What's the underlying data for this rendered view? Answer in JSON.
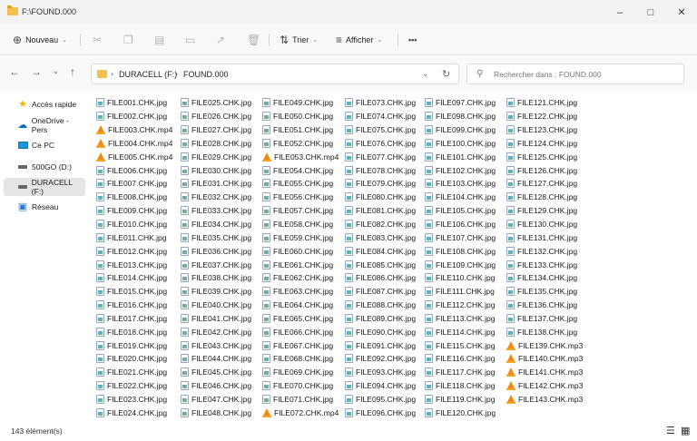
{
  "window": {
    "title": "F:\\FOUND.000"
  },
  "toolbar": {
    "new_label": "Nouveau",
    "sort_label": "Trier",
    "view_label": "Afficher",
    "more_label": "•••"
  },
  "address": {
    "drive": "DURACELL (F:)",
    "folder": "FOUND.000"
  },
  "search": {
    "placeholder": "Rechercher dans : FOUND.000"
  },
  "sidebar": {
    "items": [
      {
        "label": "Accès rapide",
        "icon": "star-icon",
        "color": "#f2b600"
      },
      {
        "label": "OneDrive - Pers",
        "icon": "cloud-icon",
        "color": "#0f6cbd"
      },
      {
        "label": "Ce PC",
        "icon": "monitor-icon",
        "color": "#0f9bd7"
      },
      {
        "label": "500GO (D:)",
        "icon": "drive-icon",
        "color": "#555555"
      },
      {
        "label": "DURACELL (F:)",
        "icon": "drive-icon",
        "color": "#555555",
        "selected": true
      },
      {
        "label": "Réseau",
        "icon": "network-icon",
        "color": "#2b7cd3"
      }
    ]
  },
  "files": [
    {
      "name": "FILE001.CHK.jpg",
      "type": "jpg"
    },
    {
      "name": "FILE002.CHK.jpg",
      "type": "jpg"
    },
    {
      "name": "FILE003.CHK.mp4",
      "type": "vlc"
    },
    {
      "name": "FILE004.CHK.mp4",
      "type": "vlc"
    },
    {
      "name": "FILE005.CHK.mp4",
      "type": "vlc"
    },
    {
      "name": "FILE006.CHK.jpg",
      "type": "jpg"
    },
    {
      "name": "FILE007.CHK.jpg",
      "type": "jpg"
    },
    {
      "name": "FILE008.CHK.jpg",
      "type": "jpg"
    },
    {
      "name": "FILE009.CHK.jpg",
      "type": "jpg"
    },
    {
      "name": "FILE010.CHK.jpg",
      "type": "jpg"
    },
    {
      "name": "FILE011.CHK.jpg",
      "type": "jpg"
    },
    {
      "name": "FILE012.CHK.jpg",
      "type": "jpg"
    },
    {
      "name": "FILE013.CHK.jpg",
      "type": "jpg"
    },
    {
      "name": "FILE014.CHK.jpg",
      "type": "jpg"
    },
    {
      "name": "FILE015.CHK.jpg",
      "type": "jpg"
    },
    {
      "name": "FILE016.CHK.jpg",
      "type": "jpg"
    },
    {
      "name": "FILE017.CHK.jpg",
      "type": "jpg"
    },
    {
      "name": "FILE018.CHK.jpg",
      "type": "jpg"
    },
    {
      "name": "FILE019.CHK.jpg",
      "type": "jpg"
    },
    {
      "name": "FILE020.CHK.jpg",
      "type": "jpg"
    },
    {
      "name": "FILE021.CHK.jpg",
      "type": "jpg"
    },
    {
      "name": "FILE022.CHK.jpg",
      "type": "jpg"
    },
    {
      "name": "FILE023.CHK.jpg",
      "type": "jpg"
    },
    {
      "name": "FILE024.CHK.jpg",
      "type": "jpg"
    },
    {
      "name": "FILE025.CHK.jpg",
      "type": "jpg"
    },
    {
      "name": "FILE026.CHK.jpg",
      "type": "jpg"
    },
    {
      "name": "FILE027.CHK.jpg",
      "type": "jpg"
    },
    {
      "name": "FILE028.CHK.jpg",
      "type": "jpg"
    },
    {
      "name": "FILE029.CHK.jpg",
      "type": "jpg"
    },
    {
      "name": "FILE030.CHK.jpg",
      "type": "jpg"
    },
    {
      "name": "FILE031.CHK.jpg",
      "type": "jpg"
    },
    {
      "name": "FILE032.CHK.jpg",
      "type": "jpg"
    },
    {
      "name": "FILE033.CHK.jpg",
      "type": "jpg"
    },
    {
      "name": "FILE034.CHK.jpg",
      "type": "jpg"
    },
    {
      "name": "FILE035.CHK.jpg",
      "type": "jpg"
    },
    {
      "name": "FILE036.CHK.jpg",
      "type": "jpg"
    },
    {
      "name": "FILE037.CHK.jpg",
      "type": "jpg"
    },
    {
      "name": "FILE038.CHK.jpg",
      "type": "jpg"
    },
    {
      "name": "FILE039.CHK.jpg",
      "type": "jpg"
    },
    {
      "name": "FILE040.CHK.jpg",
      "type": "jpg"
    },
    {
      "name": "FILE041.CHK.jpg",
      "type": "jpg"
    },
    {
      "name": "FILE042.CHK.jpg",
      "type": "jpg"
    },
    {
      "name": "FILE043.CHK.jpg",
      "type": "jpg"
    },
    {
      "name": "FILE044.CHK.jpg",
      "type": "jpg"
    },
    {
      "name": "FILE045.CHK.jpg",
      "type": "jpg"
    },
    {
      "name": "FILE046.CHK.jpg",
      "type": "jpg"
    },
    {
      "name": "FILE047.CHK.jpg",
      "type": "jpg"
    },
    {
      "name": "FILE048.CHK.jpg",
      "type": "jpg"
    },
    {
      "name": "FILE049.CHK.jpg",
      "type": "jpg"
    },
    {
      "name": "FILE050.CHK.jpg",
      "type": "jpg"
    },
    {
      "name": "FILE051.CHK.jpg",
      "type": "jpg"
    },
    {
      "name": "FILE052.CHK.jpg",
      "type": "jpg"
    },
    {
      "name": "FILE053.CHK.mp4",
      "type": "vlc"
    },
    {
      "name": "FILE054.CHK.jpg",
      "type": "jpg"
    },
    {
      "name": "FILE055.CHK.jpg",
      "type": "jpg"
    },
    {
      "name": "FILE056.CHK.jpg",
      "type": "jpg"
    },
    {
      "name": "FILE057.CHK.jpg",
      "type": "jpg"
    },
    {
      "name": "FILE058.CHK.jpg",
      "type": "jpg"
    },
    {
      "name": "FILE059.CHK.jpg",
      "type": "jpg"
    },
    {
      "name": "FILE060.CHK.jpg",
      "type": "jpg"
    },
    {
      "name": "FILE061.CHK.jpg",
      "type": "jpg"
    },
    {
      "name": "FILE062.CHK.jpg",
      "type": "jpg"
    },
    {
      "name": "FILE063.CHK.jpg",
      "type": "jpg"
    },
    {
      "name": "FILE064.CHK.jpg",
      "type": "jpg"
    },
    {
      "name": "FILE065.CHK.jpg",
      "type": "jpg"
    },
    {
      "name": "FILE066.CHK.jpg",
      "type": "jpg"
    },
    {
      "name": "FILE067.CHK.jpg",
      "type": "jpg"
    },
    {
      "name": "FILE068.CHK.jpg",
      "type": "jpg"
    },
    {
      "name": "FILE069.CHK.jpg",
      "type": "jpg"
    },
    {
      "name": "FILE070.CHK.jpg",
      "type": "jpg"
    },
    {
      "name": "FILE071.CHK.jpg",
      "type": "jpg"
    },
    {
      "name": "FILE072.CHK.mp4",
      "type": "vlc"
    },
    {
      "name": "FILE073.CHK.jpg",
      "type": "jpg"
    },
    {
      "name": "FILE074.CHK.jpg",
      "type": "jpg"
    },
    {
      "name": "FILE075.CHK.jpg",
      "type": "jpg"
    },
    {
      "name": "FILE076.CHK.jpg",
      "type": "jpg"
    },
    {
      "name": "FILE077.CHK.jpg",
      "type": "jpg"
    },
    {
      "name": "FILE078.CHK.jpg",
      "type": "jpg"
    },
    {
      "name": "FILE079.CHK.jpg",
      "type": "jpg"
    },
    {
      "name": "FILE080.CHK.jpg",
      "type": "jpg"
    },
    {
      "name": "FILE081.CHK.jpg",
      "type": "jpg"
    },
    {
      "name": "FILE082.CHK.jpg",
      "type": "jpg"
    },
    {
      "name": "FILE083.CHK.jpg",
      "type": "jpg"
    },
    {
      "name": "FILE084.CHK.jpg",
      "type": "jpg"
    },
    {
      "name": "FILE085.CHK.jpg",
      "type": "jpg"
    },
    {
      "name": "FILE086.CHK.jpg",
      "type": "jpg"
    },
    {
      "name": "FILE087.CHK.jpg",
      "type": "jpg"
    },
    {
      "name": "FILE088.CHK.jpg",
      "type": "jpg"
    },
    {
      "name": "FILE089.CHK.jpg",
      "type": "jpg"
    },
    {
      "name": "FILE090.CHK.jpg",
      "type": "jpg"
    },
    {
      "name": "FILE091.CHK.jpg",
      "type": "jpg"
    },
    {
      "name": "FILE092.CHK.jpg",
      "type": "jpg"
    },
    {
      "name": "FILE093.CHK.jpg",
      "type": "jpg"
    },
    {
      "name": "FILE094.CHK.jpg",
      "type": "jpg"
    },
    {
      "name": "FILE095.CHK.jpg",
      "type": "jpg"
    },
    {
      "name": "FILE096.CHK.jpg",
      "type": "jpg"
    },
    {
      "name": "FILE097.CHK.jpg",
      "type": "jpg"
    },
    {
      "name": "FILE098.CHK.jpg",
      "type": "jpg"
    },
    {
      "name": "FILE099.CHK.jpg",
      "type": "jpg"
    },
    {
      "name": "FILE100.CHK.jpg",
      "type": "jpg"
    },
    {
      "name": "FILE101.CHK.jpg",
      "type": "jpg"
    },
    {
      "name": "FILE102.CHK.jpg",
      "type": "jpg"
    },
    {
      "name": "FILE103.CHK.jpg",
      "type": "jpg"
    },
    {
      "name": "FILE104.CHK.jpg",
      "type": "jpg"
    },
    {
      "name": "FILE105.CHK.jpg",
      "type": "jpg"
    },
    {
      "name": "FILE106.CHK.jpg",
      "type": "jpg"
    },
    {
      "name": "FILE107.CHK.jpg",
      "type": "jpg"
    },
    {
      "name": "FILE108.CHK.jpg",
      "type": "jpg"
    },
    {
      "name": "FILE109.CHK.jpg",
      "type": "jpg"
    },
    {
      "name": "FILE110.CHK.jpg",
      "type": "jpg"
    },
    {
      "name": "FILE111.CHK.jpg",
      "type": "jpg"
    },
    {
      "name": "FILE112.CHK.jpg",
      "type": "jpg"
    },
    {
      "name": "FILE113.CHK.jpg",
      "type": "jpg"
    },
    {
      "name": "FILE114.CHK.jpg",
      "type": "jpg"
    },
    {
      "name": "FILE115.CHK.jpg",
      "type": "jpg"
    },
    {
      "name": "FILE116.CHK.jpg",
      "type": "jpg"
    },
    {
      "name": "FILE117.CHK.jpg",
      "type": "jpg"
    },
    {
      "name": "FILE118.CHK.jpg",
      "type": "jpg"
    },
    {
      "name": "FILE119.CHK.jpg",
      "type": "jpg"
    },
    {
      "name": "FILE120.CHK.jpg",
      "type": "jpg"
    },
    {
      "name": "FILE121.CHK.jpg",
      "type": "jpg"
    },
    {
      "name": "FILE122.CHK.jpg",
      "type": "jpg"
    },
    {
      "name": "FILE123.CHK.jpg",
      "type": "jpg"
    },
    {
      "name": "FILE124.CHK.jpg",
      "type": "jpg"
    },
    {
      "name": "FILE125.CHK.jpg",
      "type": "jpg"
    },
    {
      "name": "FILE126.CHK.jpg",
      "type": "jpg"
    },
    {
      "name": "FILE127.CHK.jpg",
      "type": "jpg"
    },
    {
      "name": "FILE128.CHK.jpg",
      "type": "jpg"
    },
    {
      "name": "FILE129.CHK.jpg",
      "type": "jpg"
    },
    {
      "name": "FILE130.CHK.jpg",
      "type": "jpg"
    },
    {
      "name": "FILE131.CHK.jpg",
      "type": "jpg"
    },
    {
      "name": "FILE132.CHK.jpg",
      "type": "jpg"
    },
    {
      "name": "FILE133.CHK.jpg",
      "type": "jpg"
    },
    {
      "name": "FILE134.CHK.jpg",
      "type": "jpg"
    },
    {
      "name": "FILE135.CHK.jpg",
      "type": "jpg"
    },
    {
      "name": "FILE136.CHK.jpg",
      "type": "jpg"
    },
    {
      "name": "FILE137.CHK.jpg",
      "type": "jpg"
    },
    {
      "name": "FILE138.CHK.jpg",
      "type": "jpg"
    },
    {
      "name": "FILE139.CHK.mp3",
      "type": "vlc"
    },
    {
      "name": "FILE140.CHK.mp3",
      "type": "vlc"
    },
    {
      "name": "FILE141.CHK.mp3",
      "type": "vlc"
    },
    {
      "name": "FILE142.CHK.mp3",
      "type": "vlc"
    },
    {
      "name": "FILE143.CHK.mp3",
      "type": "vlc"
    }
  ],
  "status": {
    "count_label": "143 élément(s)"
  }
}
